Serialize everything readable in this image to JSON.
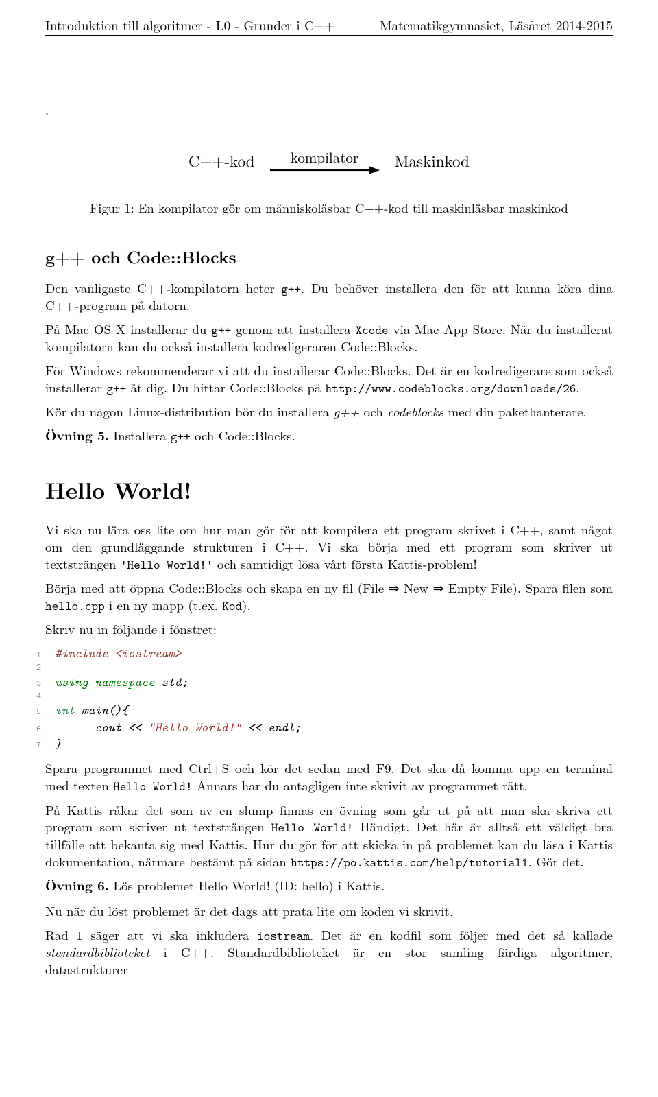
{
  "header": {
    "left": "Introduktion till algoritmer - L0 - Grunder i C++",
    "right": "Matematikgymnasiet, Läsåret 2014-2015"
  },
  "dot": ".",
  "diagram": {
    "left": "C++-kod",
    "label": "kompilator",
    "right": "Maskinkod"
  },
  "caption": "Figur 1: En kompilator gör om människoläsbar C++-kod till maskinläsbar maskinkod",
  "section_gpp": "g++ och Code::Blocks",
  "gpp": {
    "p1a": "Den vanligaste C++-kompilatorn heter ",
    "p1b": "g++",
    "p1c": ". Du behöver installera den för att kunna köra dina C++-program på datorn.",
    "p2a": "På Mac OS X installerar du ",
    "p2b": "g++",
    "p2c": " genom att installera ",
    "p2d": "Xcode",
    "p2e": " via Mac App Store. När du installerat kompilatorn kan du också installera kodredigeraren Code::Blocks.",
    "p3a": "För Windows rekommenderar vi att du installerar Code::Blocks. Det är en kodredigerare som också installerar ",
    "p3b": "g++",
    "p3c": " åt dig. Du hittar Code::Blocks på ",
    "p3d": "http://www.codeblocks.org/downloads/26",
    "p3e": ".",
    "p4a": "Kör du någon Linux-distribution bör du installera ",
    "p4b": "g++",
    "p4c": " och ",
    "p4d": "codeblocks",
    "p4e": " med din pakethanterare.",
    "ex5a": "Övning 5.",
    "ex5b": " Installera ",
    "ex5c": "g++",
    "ex5d": " och Code::Blocks."
  },
  "section_hello": "Hello World!",
  "hello": {
    "p1a": "Vi ska nu lära oss lite om hur man gör för att kompilera ett program skrivet i C++, samt något om den grundläggande strukturen i C++. Vi ska börja med ett program som skriver ut textsträngen ",
    "p1b": "'Hello World!'",
    "p1c": " och samtidigt lösa vårt första Kattis-problem!",
    "p2a": "Börja med att öppna Code::Blocks och skapa en ny fil (File ⇒ New ⇒ Empty File). Spara filen som ",
    "p2b": "hello.cpp",
    "p2c": " i en ny mapp (t.ex. ",
    "p2d": "Kod",
    "p2e": ").",
    "p3": "Skriv nu in följande i fönstret:"
  },
  "code": {
    "l1": {
      "n": "1",
      "a": "#include <iostream>"
    },
    "l2": {
      "n": "2",
      "a": ""
    },
    "l3": {
      "n": "3",
      "a": "using",
      "b": " namespace ",
      "c": "std",
      "d": ";"
    },
    "l4": {
      "n": "4",
      "a": ""
    },
    "l5": {
      "n": "5",
      "a": "int",
      "b": " main",
      "c": "(){"
    },
    "l6": {
      "n": "6",
      "indent": "      ",
      "a": "cout << ",
      "b": "\"Hello World!\"",
      "c": " << endl;"
    },
    "l7": {
      "n": "7",
      "a": "}"
    }
  },
  "after": {
    "p1a": "Spara programmet med Ctrl+S och kör det sedan med F9. Det ska då komma upp en terminal med texten ",
    "p1b": "Hello World!",
    "p1c": " Annars har du antagligen inte skrivit av programmet rätt.",
    "p2a": "På Kattis råkar det som av en slump finnas en övning som går ut på att man ska skriva ett program som skriver ut textsträngen ",
    "p2b": "Hello World!",
    "p2c": " Händigt. Det här är alltså ett väldigt bra tillfälle att bekanta sig med Kattis. Hur du gör för att skicka in på problemet kan du läsa i Kattis dokumentation, närmare bestämt på sidan ",
    "p2d": "https://po.kattis.com/help/tutorial1",
    "p2e": ". Gör det.",
    "ex6a": "Övning 6.",
    "ex6b": " Lös problemet Hello World! (ID: hello) i Kattis.",
    "p3": "Nu när du löst problemet är det dags att prata lite om koden vi skrivit.",
    "p4a": "Rad 1 säger att vi ska inkludera ",
    "p4b": "iostream",
    "p4c": ". Det är en kodfil som följer med det så kallade ",
    "p4d": "standardbiblioteket",
    "p4e": " i C++. Standardbiblioteket är en stor samling färdiga algoritmer, datastrukturer"
  }
}
